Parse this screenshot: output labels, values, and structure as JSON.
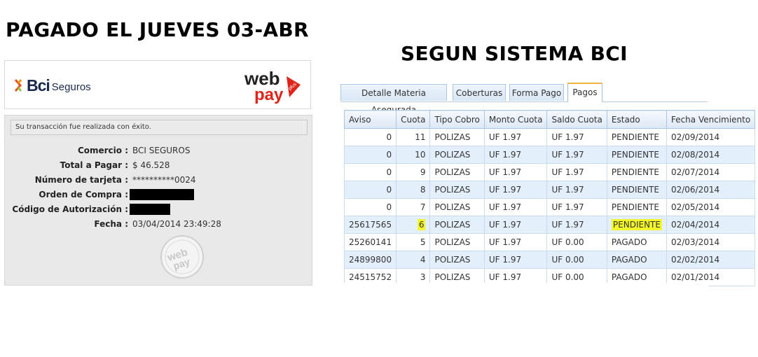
{
  "headings": {
    "left": "PAGADO EL JUEVES 03-ABR",
    "right": "SEGUN SISTEMA BCI"
  },
  "receipt": {
    "logo_text": "Bci",
    "logo_sub": "Seguros",
    "webpay_text": "web",
    "webpay_text2": "pay",
    "webpay_plus": "plus",
    "message": "Su transacción fue realizada con éxito.",
    "fields": [
      {
        "label": "Comercio :",
        "value": "BCI SEGUROS"
      },
      {
        "label": "Total a Pagar :",
        "value": "$ 46.528"
      },
      {
        "label": "Número de tarjeta :",
        "value": "**********0024"
      },
      {
        "label": "Orden de Compra :",
        "value": ""
      },
      {
        "label": "Código de Autorización :",
        "value": ""
      },
      {
        "label": "Fecha :",
        "value": "03/04/2014 23:49:28"
      }
    ]
  },
  "tabs": [
    "Detalle Materia Asegurada",
    "Coberturas",
    "Forma Pago",
    "Pagos"
  ],
  "active_tab": "Pagos",
  "table": {
    "columns": [
      "Aviso",
      "Cuota",
      "Tipo Cobro",
      "Monto Cuota",
      "Saldo Cuota",
      "Estado",
      "Fecha Vencimiento"
    ],
    "rows": [
      [
        "0",
        "11",
        "POLIZAS",
        "UF 1.97",
        "UF 1.97",
        "PENDIENTE",
        "02/09/2014"
      ],
      [
        "0",
        "10",
        "POLIZAS",
        "UF 1.97",
        "UF 1.97",
        "PENDIENTE",
        "02/08/2014"
      ],
      [
        "0",
        "9",
        "POLIZAS",
        "UF 1.97",
        "UF 1.97",
        "PENDIENTE",
        "02/07/2014"
      ],
      [
        "0",
        "8",
        "POLIZAS",
        "UF 1.97",
        "UF 1.97",
        "PENDIENTE",
        "02/06/2014"
      ],
      [
        "0",
        "7",
        "POLIZAS",
        "UF 1.97",
        "UF 1.97",
        "PENDIENTE",
        "02/05/2014"
      ],
      [
        "25617565",
        "6",
        "POLIZAS",
        "UF 1.97",
        "UF 1.97",
        "PENDIENTE",
        "02/04/2014"
      ],
      [
        "25260141",
        "5",
        "POLIZAS",
        "UF 1.97",
        "UF 0.00",
        "PAGADO",
        "02/03/2014"
      ],
      [
        "24899800",
        "4",
        "POLIZAS",
        "UF 1.97",
        "UF 0.00",
        "PAGADO",
        "02/02/2014"
      ],
      [
        "24515752",
        "3",
        "POLIZAS",
        "UF 1.97",
        "UF 0.00",
        "PAGADO",
        "02/01/2014"
      ]
    ],
    "highlight_color": "#f3f62a"
  }
}
